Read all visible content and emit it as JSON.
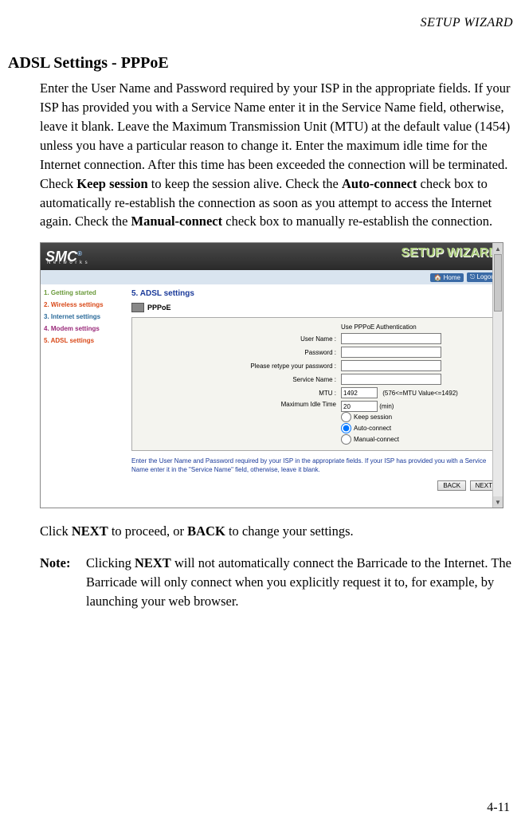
{
  "header": "SETUP WIZARD",
  "section_title": "ADSL Settings - PPPoE",
  "paragraph_parts": {
    "p1": "Enter the User Name and Password required by your ISP in the appropriate fields. If your ISP has provided you with a Service Name enter it in the Service Name field, otherwise, leave it blank. Leave the Maximum Transmission Unit (MTU) at the default value (1454) unless you have a particular reason to change it. Enter the maximum idle time for the Internet connection. After this time has been exceeded the connection will be terminated. Check ",
    "b1": "Keep session",
    "p2": " to keep the session alive. Check the ",
    "b2": "Auto-connect",
    "p3": " check box to automatically re-establish the connection as soon as you attempt to access the Internet again. Check the ",
    "b3": "Manual-connect",
    "p4": " check box to manually re-establish the connection."
  },
  "screenshot": {
    "logo": "SMC",
    "logo_sub": "N e t w o r k s",
    "wizard": "SETUP WIZARD",
    "toolbar": {
      "home": "Home",
      "logout": "Logout"
    },
    "sidebar": {
      "s1": "1. Getting started",
      "s2": "2. Wireless settings",
      "s3": "3. Internet settings",
      "s4": "4. Modem settings",
      "s5": "5. ADSL settings"
    },
    "content_title": "5. ADSL settings",
    "pppoe_label": "PPPoE",
    "form": {
      "auth_heading": "Use PPPoE Authentication",
      "user_label": "User Name :",
      "user_value": "",
      "pass_label": "Password :",
      "pass_value": "",
      "retype_label": "Please retype your password :",
      "retype_value": "",
      "service_label": "Service Name :",
      "service_value": "",
      "mtu_label": "MTU :",
      "mtu_value": "1492",
      "mtu_hint": "(576<=MTU Value<=1492)",
      "idle_label": "Maximum Idle Time",
      "idle_value": "20",
      "idle_unit": "(min)",
      "opt_keep": "Keep session",
      "opt_auto": "Auto-connect",
      "opt_manual": "Manual-connect"
    },
    "helper": "Enter the User Name and Password required by your ISP in the appropriate fields. If your ISP has provided you with a Service Name enter it in the \"Service Name\" field, otherwise, leave it blank.",
    "btn_back": "BACK",
    "btn_next": "NEXT"
  },
  "after": {
    "t1": "Click ",
    "b1": "NEXT",
    "t2": " to proceed, or ",
    "b2": "BACK",
    "t3": " to change your settings."
  },
  "note": {
    "label": "Note:",
    "t1": "Clicking ",
    "b1": "NEXT",
    "t2": " will not automatically connect the Barricade to the Internet. The Barricade will only connect when you explicitly request it to, for example, by launching your web browser."
  },
  "page_number": "4-11"
}
